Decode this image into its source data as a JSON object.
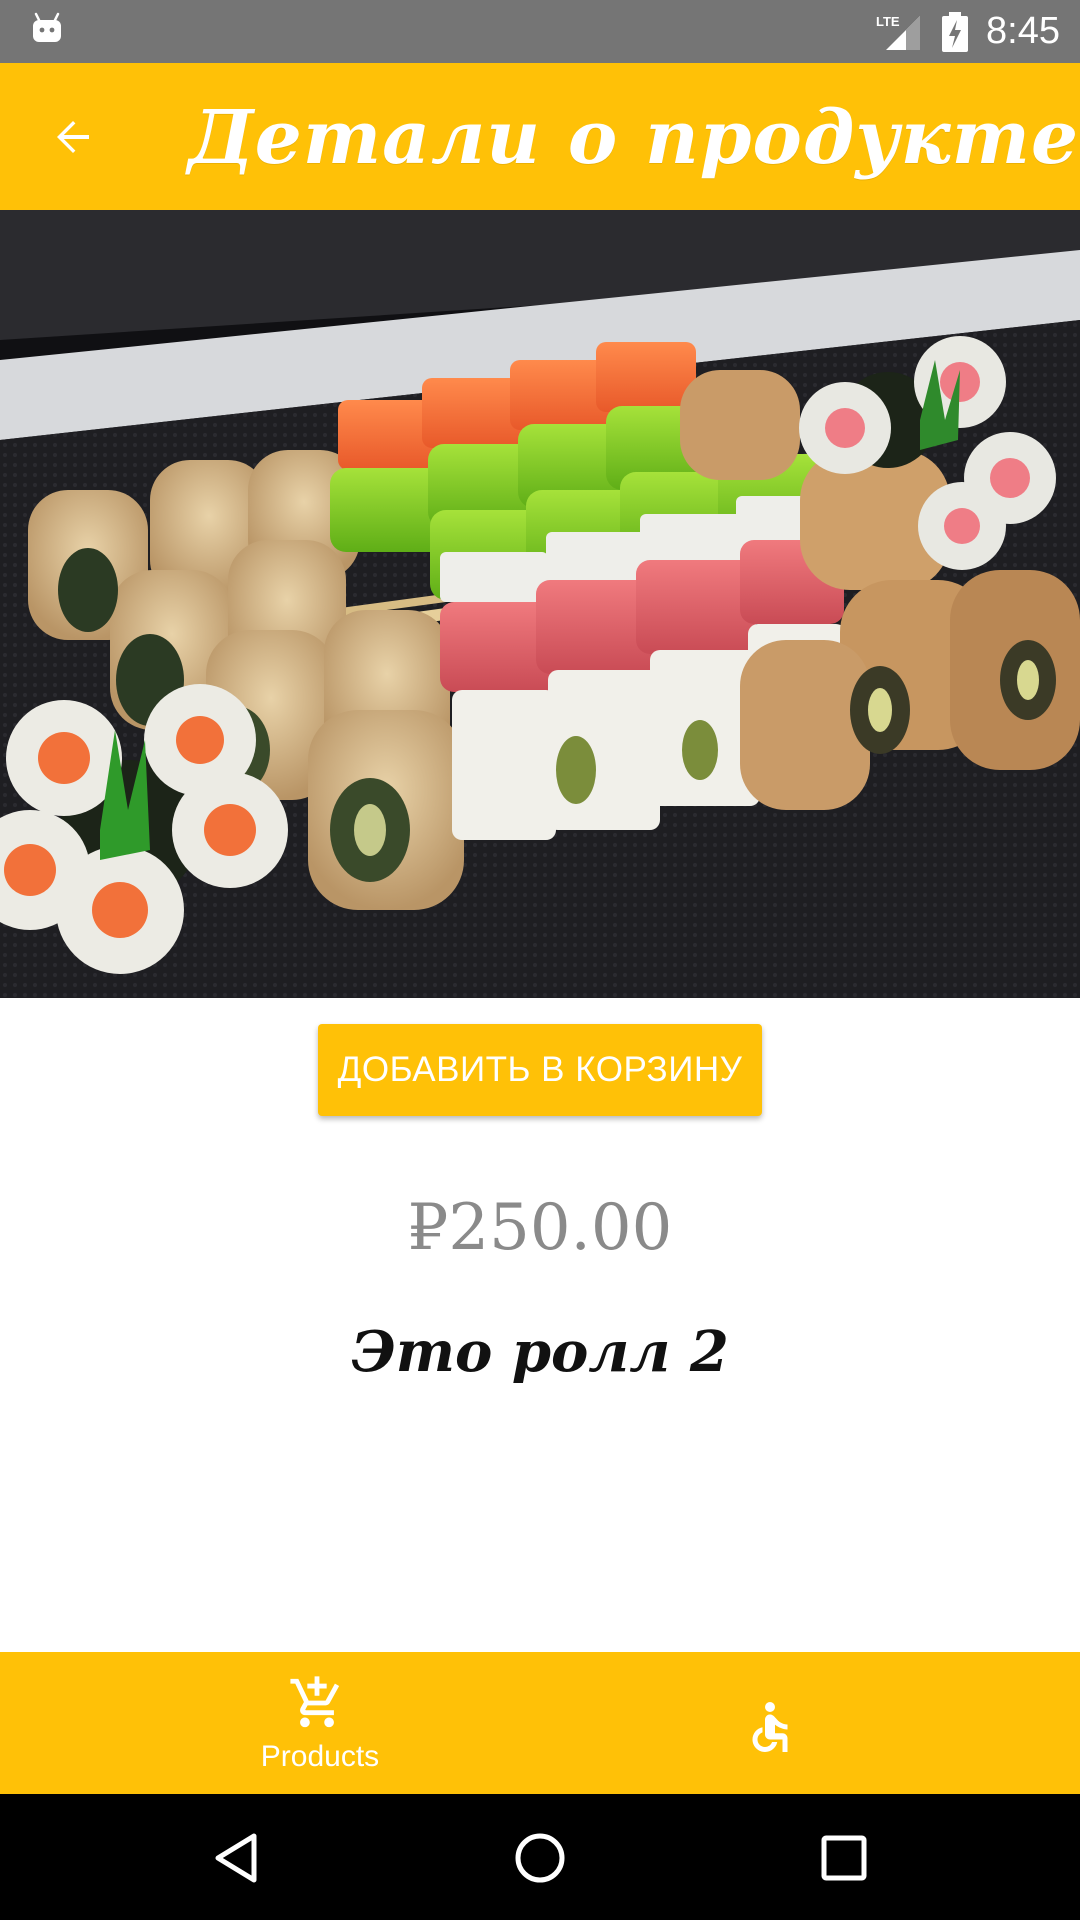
{
  "status_bar": {
    "time": "8:45",
    "network_label": "LTE",
    "icons": [
      "android-icon",
      "lte-signal-icon",
      "battery-charging-icon"
    ]
  },
  "toolbar": {
    "title": "Детали о продукте",
    "back_icon": "arrow-back-icon"
  },
  "product": {
    "image_alt": "sushi rolls",
    "add_to_cart_label": "ДОБАВИТЬ В КОРЗИНУ",
    "price": "₽250.00",
    "name": "Это ролл  2"
  },
  "bottom_nav": {
    "items": [
      {
        "label": "Products",
        "icon": "add-shopping-cart-icon"
      },
      {
        "label": "",
        "icon": "accessible-icon"
      }
    ]
  },
  "system_nav": {
    "buttons": [
      "back-triangle-icon",
      "home-circle-icon",
      "recents-square-icon"
    ]
  },
  "colors": {
    "accent": "#ffc107",
    "status_bar": "#757575",
    "price_text": "#8a8a8a",
    "system_nav": "#000000"
  }
}
